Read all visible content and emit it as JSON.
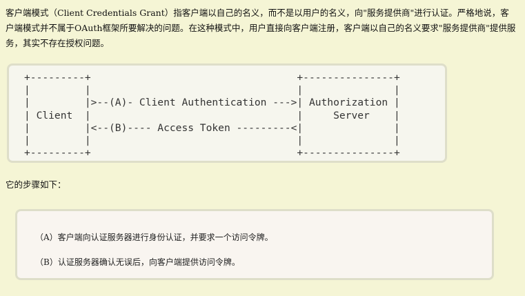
{
  "intro": {
    "paragraph": "客户端模式（Client Credentials Grant）指客户端以自己的名义，而不是以用户的名义，向\"服务提供商\"进行认证。严格地说，客户端模式并不属于OAuth框架所要解决的问题。在这种模式中，用户直接向客户端注册，客户端以自己的名义要求\"服务提供商\"提供服务，其实不存在授权问题。"
  },
  "diagram": {
    "ascii": "+---------+                                  +---------------+\n|         |                                  |               |\n|         |>--(A)- Client Authentication --->| Authorization |\n| Client  |                                  |     Server    |\n|         |<--(B)---- Access Token ---------<|               |\n|         |                                  |               |\n+---------+                                  +---------------+"
  },
  "steps": {
    "label": "它的步骤如下：",
    "items": [
      "（A）客户端向认证服务器进行身份认证，并要求一个访问令牌。",
      "（B）认证服务器确认无误后，向客户端提供访问令牌。"
    ]
  }
}
